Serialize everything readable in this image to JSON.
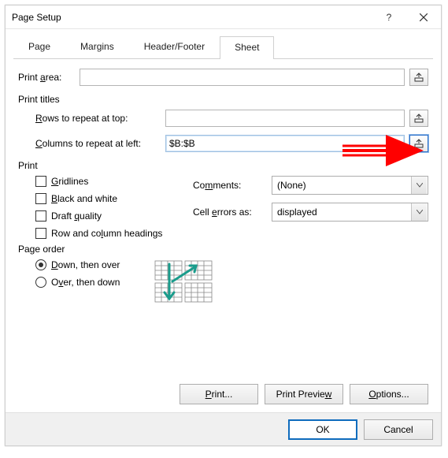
{
  "titlebar": {
    "title": "Page Setup"
  },
  "tabs": {
    "page": "Page",
    "margins": "Margins",
    "header_footer": "Header/Footer",
    "sheet": "Sheet",
    "active": "sheet"
  },
  "print_area": {
    "label": "Print area:",
    "value": ""
  },
  "print_titles": {
    "title": "Print titles",
    "rows_label": "Rows to repeat at top:",
    "rows_value": "",
    "cols_label": "Columns to repeat at left:",
    "cols_value": "$B:$B"
  },
  "print": {
    "title": "Print",
    "gridlines": "Gridlines",
    "bw": "Black and white",
    "draft": "Draft quality",
    "rowcol": "Row and column headings",
    "comments_label": "Comments:",
    "comments_value": "(None)",
    "cellerrors_label": "Cell errors as:",
    "cellerrors_value": "displayed"
  },
  "page_order": {
    "title": "Page order",
    "down_over": "Down, then over",
    "over_down": "Over, then down"
  },
  "buttons": {
    "print": "Print...",
    "preview": "Print Preview",
    "options": "Options...",
    "ok": "OK",
    "cancel": "Cancel"
  }
}
